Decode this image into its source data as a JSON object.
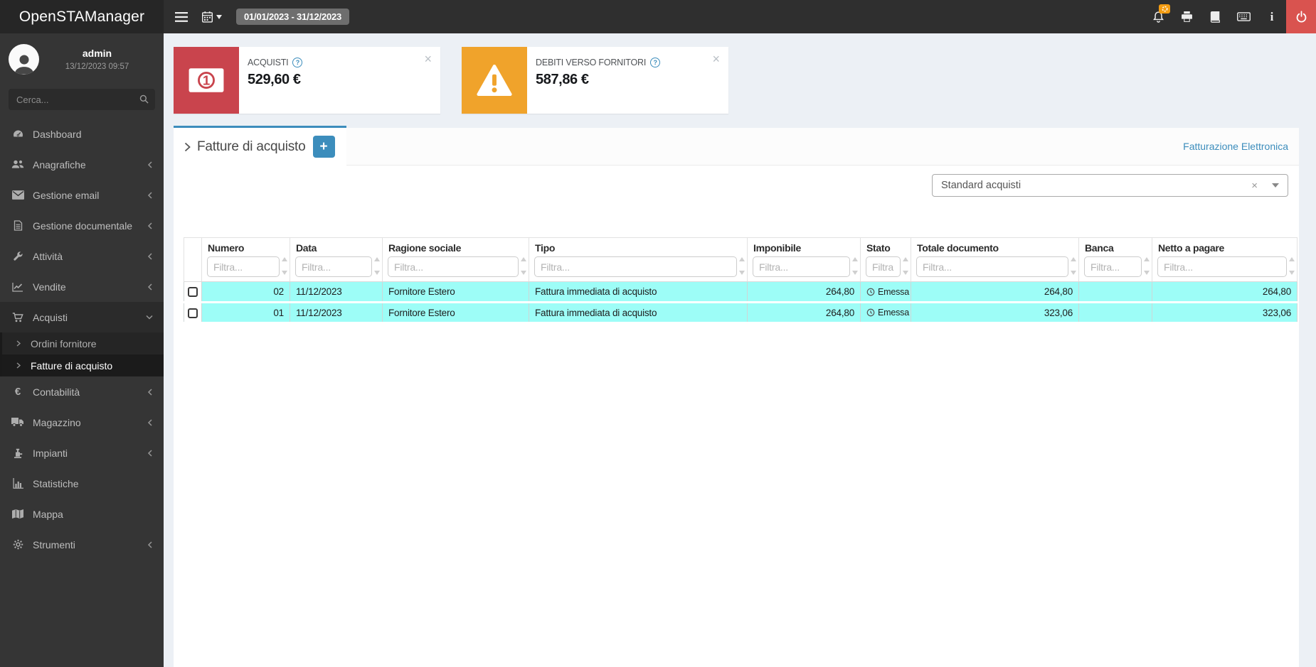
{
  "topbar": {
    "brand": "OpenSTAManager",
    "date_range": "01/01/2023 - 31/12/2023"
  },
  "sidebar": {
    "user": {
      "name": "admin",
      "datetime": "13/12/2023 09:57"
    },
    "search_placeholder": "Cerca...",
    "items": [
      {
        "label": "Dashboard"
      },
      {
        "label": "Anagrafiche"
      },
      {
        "label": "Gestione email"
      },
      {
        "label": "Gestione documentale"
      },
      {
        "label": "Attività"
      },
      {
        "label": "Vendite"
      },
      {
        "label": "Acquisti",
        "children": [
          {
            "label": "Ordini fornitore"
          },
          {
            "label": "Fatture di acquisto"
          }
        ]
      },
      {
        "label": "Contabilità"
      },
      {
        "label": "Magazzino"
      },
      {
        "label": "Impianti"
      },
      {
        "label": "Statistiche"
      },
      {
        "label": "Mappa"
      },
      {
        "label": "Strumenti"
      }
    ]
  },
  "infoboxes": [
    {
      "title": "ACQUISTI",
      "value": "529,60 €"
    },
    {
      "title": "DEBITI VERSO FORNITORI",
      "value": "587,86 €"
    }
  ],
  "panel": {
    "tab_title": "Fatture di acquisto",
    "link_label": "Fatturazione Elettronica"
  },
  "filter_select": {
    "value": "Standard acquisti"
  },
  "table": {
    "filter_placeholder": "Filtra...",
    "columns": [
      "Numero",
      "Data",
      "Ragione sociale",
      "Tipo",
      "Imponibile",
      "Stato",
      "Totale documento",
      "Banca",
      "Netto a pagare"
    ],
    "rows": [
      {
        "numero": "02",
        "data": "11/12/2023",
        "ragione_sociale": "Fornitore Estero",
        "tipo": "Fattura immediata di acquisto",
        "imponibile": "264,80",
        "stato": "Emessa",
        "totale_documento": "264,80",
        "banca": "",
        "netto_a_pagare": "264,80"
      },
      {
        "numero": "01",
        "data": "11/12/2023",
        "ragione_sociale": "Fornitore Estero",
        "tipo": "Fattura immediata di acquisto",
        "imponibile": "264,80",
        "stato": "Emessa",
        "totale_documento": "323,06",
        "banca": "",
        "netto_a_pagare": "323,06"
      }
    ]
  },
  "icons": {
    "plus": "+",
    "close": "×",
    "clear": "×",
    "help": "?",
    "info": "i"
  },
  "colors": {
    "accent_blue": "#3c8dbc",
    "box_red": "#c9444d",
    "box_orange": "#f0a32b",
    "power_red": "#d9534f",
    "badge_orange": "#f39c12",
    "row_highlight": "#9dfdf7",
    "topbar_bg": "#2f2f2f",
    "sidebar_bg": "#353535",
    "page_bg": "#ecf0f5"
  }
}
